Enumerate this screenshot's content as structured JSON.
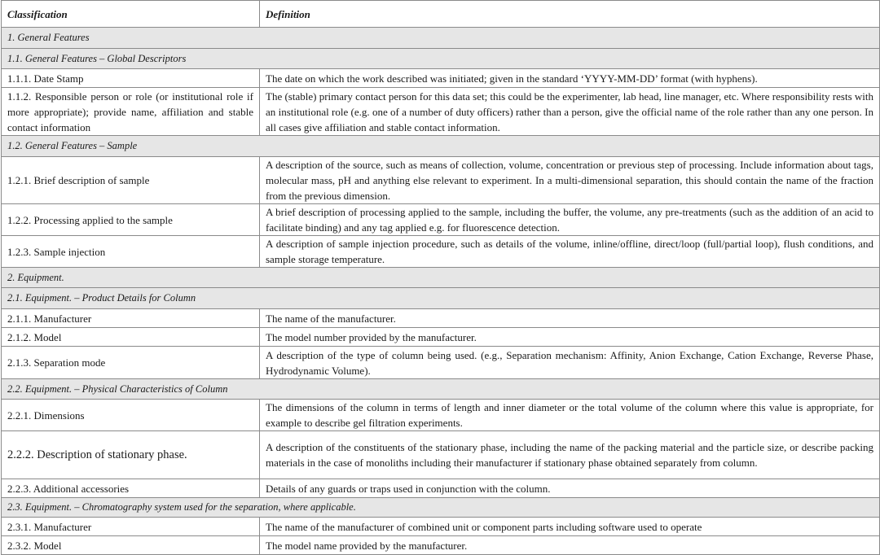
{
  "table": {
    "headers": {
      "classification": "Classification",
      "definition": "Definition"
    },
    "rows": [
      {
        "type": "section",
        "label": "1. General Features"
      },
      {
        "type": "section",
        "label": "1.1.  General Features – Global Descriptors"
      },
      {
        "type": "item",
        "classification": "1.1.1. Date Stamp",
        "definition": "The date on which the work described was initiated; given in the standard ‘YYYY-MM-DD’ format (with hyphens)."
      },
      {
        "type": "item",
        "classification": "1.1.2. Responsible person or role (or institutional role if more appropriate); provide name, affiliation and stable contact information",
        "definition": "The (stable) primary contact person for this data set; this could be the experimenter, lab head, line manager, etc. Where responsibility rests with an institutional role (e.g. one of a number of duty officers) rather than a person, give the official name of the role rather than any one person. In all cases give affiliation and stable contact information."
      },
      {
        "type": "section",
        "label": "1.2.  General Features – Sample"
      },
      {
        "type": "item",
        "classification": "1.2.1. Brief description of sample",
        "definition": "A description of the source, such as means of collection, volume, concentration or previous step of processing. Include information about tags, molecular mass, pH and anything else relevant to experiment. In a multi-dimensional separation, this should contain the name of the fraction from the previous dimension."
      },
      {
        "type": "item",
        "classification": "1.2.2. Processing applied to the sample",
        "definition": "A brief description of processing applied to the sample, including the buffer, the volume, any pre-treatments (such as the addition of an acid to facilitate binding) and any tag applied e.g. for fluorescence detection."
      },
      {
        "type": "item",
        "classification": "1.2.3. Sample injection",
        "definition": "A description of sample injection procedure, such as details of the volume, inline/offline, direct/loop (full/partial loop), flush conditions, and sample storage temperature."
      },
      {
        "type": "section",
        "label": "2. Equipment."
      },
      {
        "type": "section",
        "label": "2.1. Equipment. – Product Details for Column"
      },
      {
        "type": "item",
        "classification": "2.1.1. Manufacturer",
        "definition": "The name of the manufacturer."
      },
      {
        "type": "item",
        "classification": "2.1.2. Model",
        "definition": "The model number provided by the manufacturer."
      },
      {
        "type": "item",
        "classification": "2.1.3. Separation mode",
        "definition": "A description of the type of column being used. (e.g., Separation mechanism: Affinity, Anion Exchange, Cation Exchange, Reverse Phase, Hydrodynamic Volume)."
      },
      {
        "type": "section",
        "label": "2.2. Equipment. – Physical Characteristics of Column"
      },
      {
        "type": "item",
        "classification": "2.2.1. Dimensions",
        "definition": "The dimensions of the column in terms of length and inner diameter or the total volume of the column where this value is appropriate, for example to describe gel filtration experiments."
      },
      {
        "type": "item",
        "classification": "2.2.2. Description of stationary phase.",
        "definition": "A description of the constituents of the stationary phase, including the name of the packing material and the particle size, or describe packing materials in the case of monoliths including their manufacturer if stationary phase obtained separately from column."
      },
      {
        "type": "item",
        "classification": "2.2.3. Additional accessories",
        "definition": "Details of any guards or traps used in conjunction with the column."
      },
      {
        "type": "section",
        "label": "2.3. Equipment. – Chromatography system used for the separation, where applicable."
      },
      {
        "type": "item",
        "classification": "2.3.1. Manufacturer",
        "definition": "The name of the manufacturer of combined unit or component parts including software used to operate"
      },
      {
        "type": "item",
        "classification": "2.3.2. Model",
        "definition": "The model name provided by the manufacturer."
      }
    ]
  }
}
